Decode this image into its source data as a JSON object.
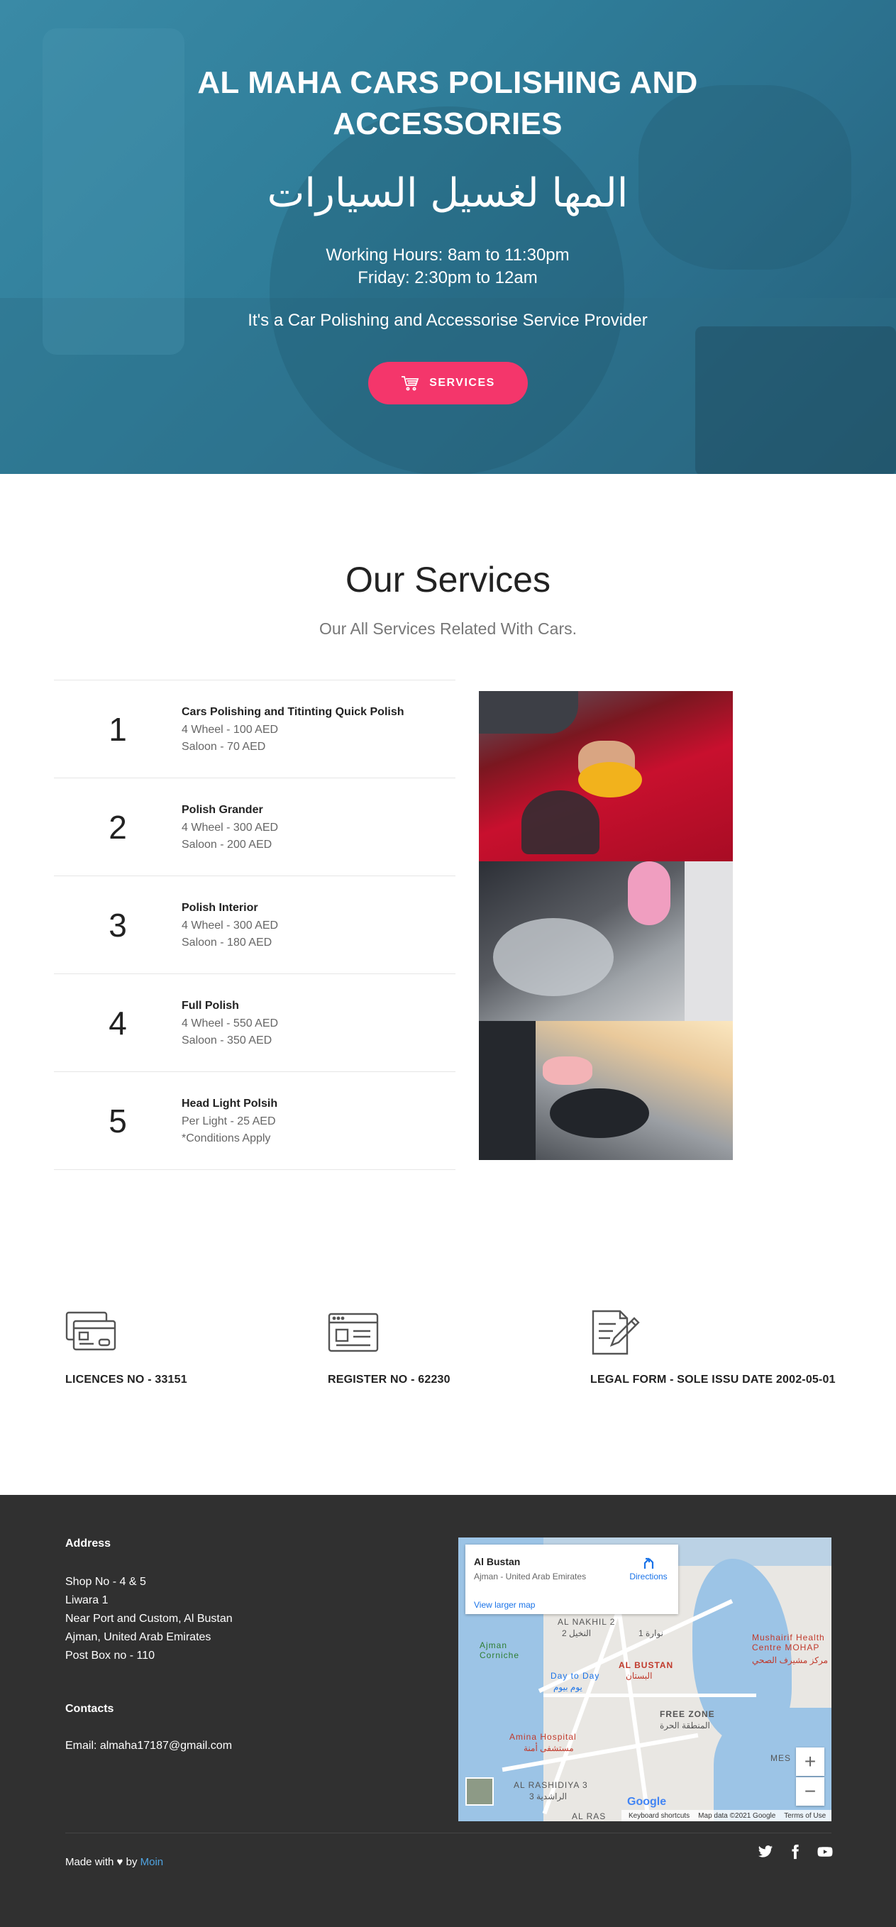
{
  "hero": {
    "title": "AL MAHA CARS POLISHING AND ACCESSORIES",
    "arabic_title": "المها لغسيل السيارات",
    "hours_line1": "Working Hours: 8am to 11:30pm",
    "hours_line2": "Friday: 2:30pm to 12am",
    "tagline": "It's a Car Polishing and Accessorise Service Provider",
    "button_label": "SERVICES",
    "button_icon": "cart-icon",
    "button_color": "#f4366b"
  },
  "services": {
    "title": "Our Services",
    "subtitle": "Our All Services Related With Cars.",
    "items": [
      {
        "number": "1",
        "name": "Cars Polishing and Titinting Quick Polish",
        "line1": "4 Wheel - 100 AED",
        "line2": "Saloon - 70 AED"
      },
      {
        "number": "2",
        "name": "Polish Grander",
        "line1": "4 Wheel - 300 AED",
        "line2": "Saloon - 200 AED"
      },
      {
        "number": "3",
        "name": "Polish Interior",
        "line1": "4 Wheel - 300 AED",
        "line2": "Saloon - 180 AED"
      },
      {
        "number": "4",
        "name": "Full Polish",
        "line1": "4 Wheel - 550 AED",
        "line2": "Saloon - 350 AED"
      },
      {
        "number": "5",
        "name": "Head Light Polsih",
        "line1": "Per Light - 25 AED",
        "line2": "*Conditions Apply"
      }
    ]
  },
  "info": [
    {
      "icon": "credit-card-icon",
      "label": "LICENCES NO - 33151"
    },
    {
      "icon": "id-card-icon",
      "label": "REGISTER NO - 62230"
    },
    {
      "icon": "document-edit-icon",
      "label": "LEGAL FORM - SOLE ISSU DATE 2002-05-01"
    }
  ],
  "footer": {
    "address_heading": "Address",
    "address_lines": [
      "Shop No - 4 & 5",
      "Liwara 1",
      "Near Port and Custom, Al Bustan",
      "Ajman, United Arab Emirates",
      "Post Box no - 110"
    ],
    "contacts_heading": "Contacts",
    "email": "Email: almaha17187@gmail.com",
    "made_with": "Made with",
    "by": "by",
    "author": "Moin",
    "map": {
      "place_name": "Al Bustan",
      "place_address": "Ajman - United Arab Emirates",
      "directions": "Directions",
      "larger_map": "View larger map",
      "labels": [
        "AL NAKHIL 2",
        "النخيل 2",
        "نوارة 1",
        "AL BUSTAN",
        "البستان",
        "Ajman Corniche",
        "Day to Day",
        "يوم بيوم",
        "FREE ZONE",
        "المنطقة الحرة",
        "Amina Hospital",
        "مستشفى أمنة",
        "Mushairif Health Centre MOHAP",
        "مركز مشيرف الصحي",
        "AL RASHIDIYA 3",
        "الراشدية 3",
        "MES",
        "AL RAS"
      ],
      "attribution": [
        "Google",
        "Keyboard shortcuts",
        "Map data ©2021 Google",
        "Terms of Use"
      ],
      "zoom_in": "+",
      "zoom_out": "−"
    },
    "socials": [
      "twitter-icon",
      "facebook-icon",
      "youtube-icon"
    ]
  }
}
